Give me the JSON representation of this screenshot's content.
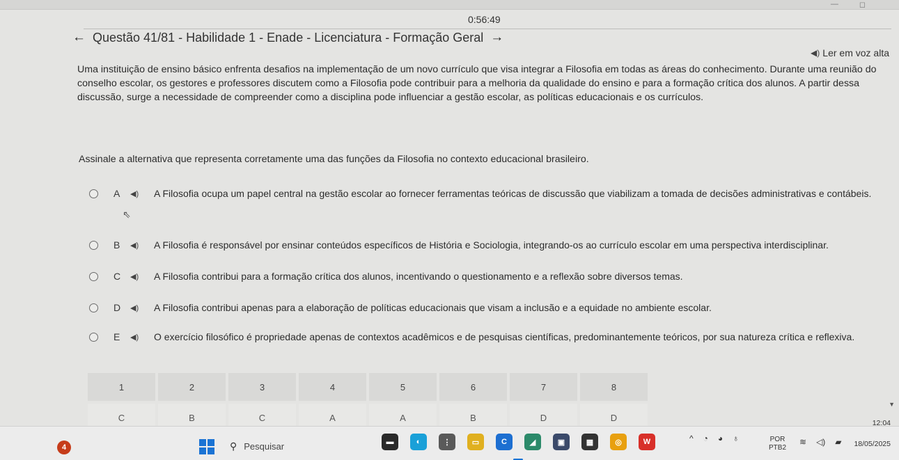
{
  "timer": "0:56:49",
  "header": {
    "title": "Questão 41/81 - Habilidade 1 - Enade - Licenciatura - Formação Geral",
    "read_aloud": "Ler em voz alta"
  },
  "statement": "Uma instituição de ensino básico enfrenta desafios na implementação de um novo currículo que visa integrar a Filosofia em todas as áreas do conhecimento. Durante uma reunião do conselho escolar, os gestores e professores discutem como a Filosofia pode contribuir para a melhoria da qualidade do ensino e para a formação crítica dos alunos. A partir dessa discussão, surge a necessidade de compreender como a disciplina pode influenciar a gestão escolar, as políticas educacionais e os currículos.",
  "prompt": "Assinale a alternativa que representa corretamente uma das funções da Filosofia no contexto educacional brasileiro.",
  "options": [
    {
      "letter": "A",
      "text": "A Filosofia ocupa um papel central na gestão escolar ao fornecer ferramentas teóricas de discussão que viabilizam a tomada de decisões administrativas e contábeis."
    },
    {
      "letter": "B",
      "text": "A Filosofia é responsável por ensinar conteúdos específicos de História e Sociologia, integrando-os ao currículo escolar em uma perspectiva interdisciplinar."
    },
    {
      "letter": "C",
      "text": "A Filosofia contribui para a formação crítica dos alunos, incentivando o questionamento e a reflexão sobre diversos temas."
    },
    {
      "letter": "D",
      "text": "A Filosofia contribui apenas para a elaboração de políticas educacionais que visam a inclusão e a equidade no ambiente escolar."
    },
    {
      "letter": "E",
      "text": "O exercício filosófico é propriedade apenas de contextos acadêmicos e de pesquisas científicas, predominantemente teóricos, por sua natureza crítica e reflexiva."
    }
  ],
  "nav": {
    "numbers": [
      "1",
      "2",
      "3",
      "4",
      "5",
      "6",
      "7",
      "8"
    ],
    "answers": [
      "C",
      "B",
      "C",
      "A",
      "A",
      "B",
      "D",
      "D"
    ]
  },
  "taskbar": {
    "badge": "4",
    "search_placeholder": "Pesquisar",
    "lang_top": "POR",
    "lang_bottom": "PTB2",
    "time": "12:04",
    "date": "18/05/2025"
  },
  "icons": {
    "back": "arrow-left-icon",
    "forward": "arrow-right-icon",
    "speaker": "speaker-icon",
    "start": "windows-start-icon",
    "search": "search-icon"
  }
}
